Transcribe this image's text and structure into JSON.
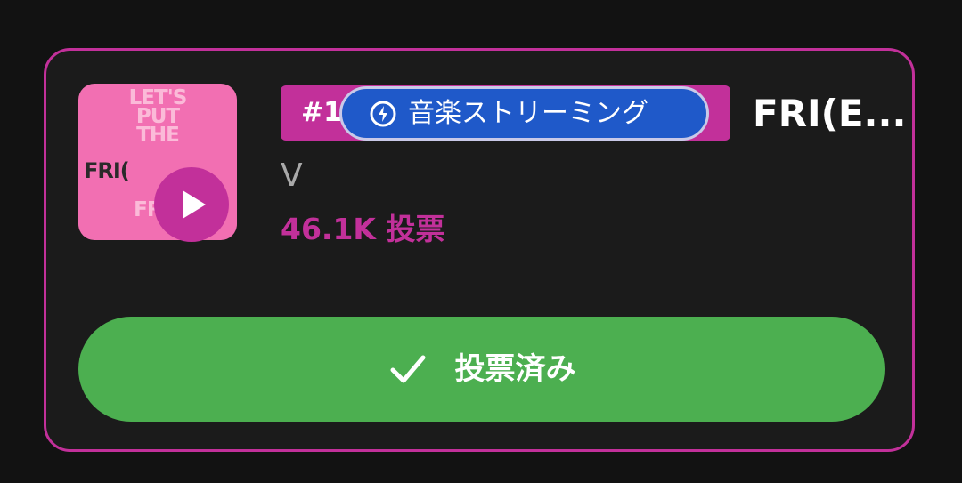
{
  "card": {
    "border_color": "#c2309a",
    "background": "#1b1b1b"
  },
  "album": {
    "cover_lines": [
      "LET'S",
      "PUT",
      "THE",
      "",
      "",
      "FRIE"
    ],
    "cover_frie": "FRI(",
    "cover_color": "#f26fb2",
    "play_icon": "play-icon"
  },
  "rank": {
    "label": "#1",
    "color": "#c2309a"
  },
  "streaming": {
    "icon": "lightning-bolt-icon",
    "label": "音楽ストリーミング",
    "color": "#1f59c9"
  },
  "song": {
    "title": "FRI(E..."
  },
  "artist": {
    "name": "V"
  },
  "votes": {
    "text": "46.1K 投票"
  },
  "vote_button": {
    "icon": "check-icon",
    "label": "投票済み",
    "color": "#4caf50"
  }
}
